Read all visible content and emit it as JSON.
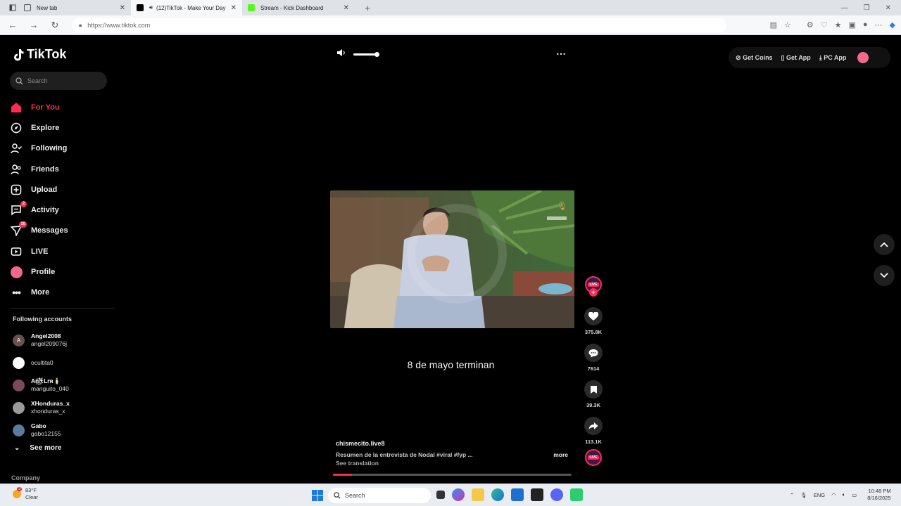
{
  "browser": {
    "tabs": [
      {
        "title": "New tab",
        "active": false
      },
      {
        "title": "(12)TikTok - Make Your Day",
        "active": true
      },
      {
        "title": "Stream - Kick Dashboard",
        "active": false
      }
    ],
    "url": "https://www.tiktok.com"
  },
  "app": {
    "logo_text": "TikTok",
    "search_placeholder": "Search",
    "nav": [
      {
        "label": "For You",
        "icon": "home-icon",
        "active": true
      },
      {
        "label": "Explore",
        "icon": "compass-icon"
      },
      {
        "label": "Following",
        "icon": "following-icon"
      },
      {
        "label": "Friends",
        "icon": "friends-icon"
      },
      {
        "label": "Upload",
        "icon": "upload-icon"
      },
      {
        "label": "Activity",
        "icon": "activity-icon",
        "badge": "2"
      },
      {
        "label": "Messages",
        "icon": "messages-icon",
        "badge": "10"
      },
      {
        "label": "LIVE",
        "icon": "live-icon"
      },
      {
        "label": "Profile",
        "icon": "profile-avatar"
      },
      {
        "label": "More",
        "icon": "more-icon"
      }
    ],
    "following_title": "Following accounts",
    "accounts": [
      {
        "name": "Angel2008",
        "handle": "angel209076j",
        "initial": "A",
        "color": "#6b4f4f"
      },
      {
        "name": "ocultita0",
        "handle": "",
        "initial": "",
        "color": "#ffffff"
      },
      {
        "name": "An꙰ꀘL𝗋ʀ🕯️",
        "handle": "manguito_040",
        "initial": "",
        "color": "#7a4a5a"
      },
      {
        "name": "XHonduras_x",
        "handle": "xhonduras_x",
        "initial": "",
        "color": "#9a9a9a"
      },
      {
        "name": "Gabo",
        "handle": "gabo12155",
        "initial": "",
        "color": "#5a7aa0"
      }
    ],
    "see_more": "See more",
    "company": "Company",
    "top_right": {
      "coins": "Get Coins",
      "get_app": "Get App",
      "pc_app": "PC App"
    },
    "video": {
      "overlay_caption": "8 de mayo terminan",
      "author": "chismecito.live8",
      "description": "Resumen de la entrevista de Nodal #viral  #fyp  ...",
      "more": "more",
      "translate": "See translation",
      "progress": 0.08,
      "live_label": "LIVE"
    },
    "actions": {
      "likes": "375.8K",
      "comments": "7614",
      "saves": "39.3K",
      "shares": "113.1K"
    }
  },
  "taskbar": {
    "temp": "83°F",
    "condition": "Clear",
    "weather_badge": "3",
    "search": "Search",
    "lang": "ENG",
    "time": "10:48 PM",
    "date": "8/16/2025"
  }
}
